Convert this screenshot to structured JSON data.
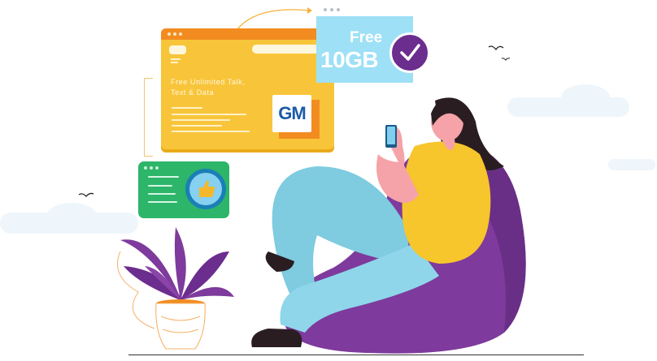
{
  "browser_card": {
    "promo_text": "Free Unlimited Talk,\nText & Data",
    "logo_text": "GM"
  },
  "free_badge": {
    "line1": "Free",
    "line2": "10GB"
  },
  "icons": {
    "check": "check-icon",
    "thumbs_up": "thumbs-up-icon"
  },
  "colors": {
    "card_yellow": "#f8c53a",
    "card_orange": "#f28c20",
    "badge_blue": "#9ee0f6",
    "check_purple": "#6b2d8e",
    "chat_green": "#2db56a",
    "beanbag_purple": "#7e3a9c",
    "shirt_yellow": "#f7c52c",
    "pants_blue": "#7fcbe0"
  }
}
